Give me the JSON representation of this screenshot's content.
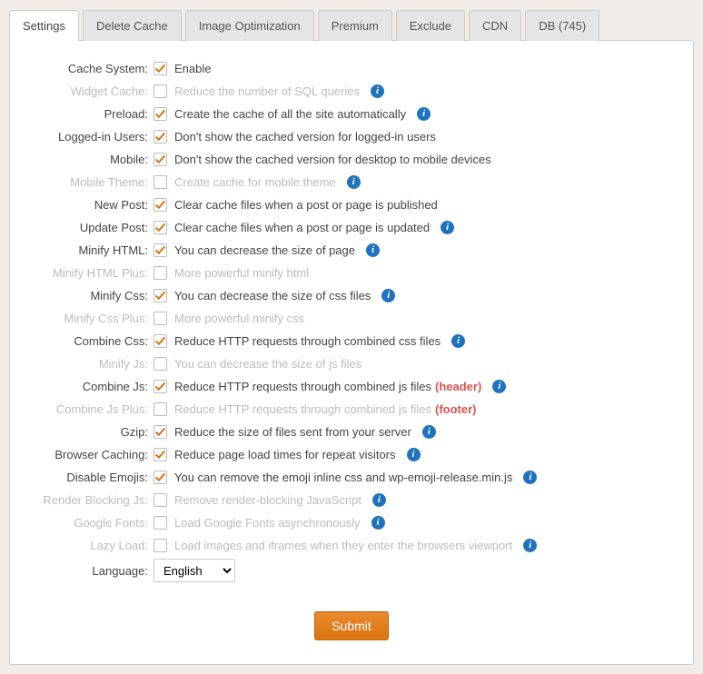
{
  "tabs": [
    {
      "label": "Settings",
      "active": true
    },
    {
      "label": "Delete Cache",
      "active": false
    },
    {
      "label": "Image Optimization",
      "active": false
    },
    {
      "label": "Premium",
      "active": false
    },
    {
      "label": "Exclude",
      "active": false
    },
    {
      "label": "CDN",
      "active": false
    },
    {
      "label": "DB (745)",
      "active": false
    }
  ],
  "rows": [
    {
      "label": "Cache System:",
      "checked": true,
      "disabled": false,
      "desc": "Enable",
      "info": false
    },
    {
      "label": "Widget Cache:",
      "checked": false,
      "disabled": true,
      "desc": "Reduce the number of SQL queries",
      "info": true
    },
    {
      "label": "Preload:",
      "checked": true,
      "disabled": false,
      "desc": "Create the cache of all the site automatically",
      "info": true
    },
    {
      "label": "Logged-in Users:",
      "checked": true,
      "disabled": false,
      "desc": "Don't show the cached version for logged-in users",
      "info": false
    },
    {
      "label": "Mobile:",
      "checked": true,
      "disabled": false,
      "desc": "Don't show the cached version for desktop to mobile devices",
      "info": false
    },
    {
      "label": "Mobile Theme:",
      "checked": false,
      "disabled": true,
      "desc": "Create cache for mobile theme",
      "info": true
    },
    {
      "label": "New Post:",
      "checked": true,
      "disabled": false,
      "desc": "Clear cache files when a post or page is published",
      "info": false
    },
    {
      "label": "Update Post:",
      "checked": true,
      "disabled": false,
      "desc": "Clear cache files when a post or page is updated",
      "info": true
    },
    {
      "label": "Minify HTML:",
      "checked": true,
      "disabled": false,
      "desc": "You can decrease the size of page",
      "info": true
    },
    {
      "label": "Minify HTML Plus:",
      "checked": false,
      "disabled": true,
      "desc": "More powerful minify html",
      "info": false
    },
    {
      "label": "Minify Css:",
      "checked": true,
      "disabled": false,
      "desc": "You can decrease the size of css files",
      "info": true
    },
    {
      "label": "Minify Css Plus:",
      "checked": false,
      "disabled": true,
      "desc": "More powerful minify css",
      "info": false
    },
    {
      "label": "Combine Css:",
      "checked": true,
      "disabled": false,
      "desc": "Reduce HTTP requests through combined css files",
      "info": true
    },
    {
      "label": "Minify Js:",
      "checked": false,
      "disabled": true,
      "desc": "You can decrease the size of js files",
      "info": false
    },
    {
      "label": "Combine Js:",
      "checked": true,
      "disabled": false,
      "desc": "Reduce HTTP requests through combined js files",
      "extra": "(header)",
      "info": true
    },
    {
      "label": "Combine Js Plus:",
      "checked": false,
      "disabled": true,
      "desc": "Reduce HTTP requests through combined js files",
      "extra": "(footer)",
      "info": false
    },
    {
      "label": "Gzip:",
      "checked": true,
      "disabled": false,
      "desc": "Reduce the size of files sent from your server",
      "info": true
    },
    {
      "label": "Browser Caching:",
      "checked": true,
      "disabled": false,
      "desc": "Reduce page load times for repeat visitors",
      "info": true
    },
    {
      "label": "Disable Emojis:",
      "checked": true,
      "disabled": false,
      "desc": "You can remove the emoji inline css and wp-emoji-release.min.js",
      "info": true
    },
    {
      "label": "Render Blocking Js:",
      "checked": false,
      "disabled": true,
      "desc": "Remove render-blocking JavaScript",
      "info": true
    },
    {
      "label": "Google Fonts:",
      "checked": false,
      "disabled": true,
      "desc": "Load Google Fonts asynchronously",
      "info": true
    },
    {
      "label": "Lazy Load:",
      "checked": false,
      "disabled": true,
      "desc": "Load images and iframes when they enter the browsers viewport",
      "info": true
    }
  ],
  "language": {
    "label": "Language:",
    "value": "English"
  },
  "submit_label": "Submit",
  "info_glyph": "i"
}
